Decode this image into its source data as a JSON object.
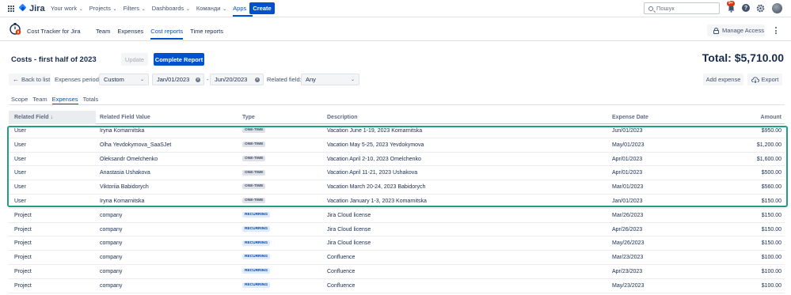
{
  "topnav": {
    "brand": "Jira",
    "menu": [
      {
        "label": "Your work",
        "active": false
      },
      {
        "label": "Projects",
        "active": false
      },
      {
        "label": "Filters",
        "active": false
      },
      {
        "label": "Dashboards",
        "active": false
      },
      {
        "label": "Команди",
        "active": false
      },
      {
        "label": "Apps",
        "active": true
      }
    ],
    "create_label": "Create",
    "search_placeholder": "Пошук",
    "notifications_badge": "9+",
    "help_label": "?"
  },
  "app": {
    "name": "Cost Tracker for Jira",
    "tabs": [
      {
        "label": "Team",
        "active": false
      },
      {
        "label": "Expenses",
        "active": false
      },
      {
        "label": "Cost reports",
        "active": true
      },
      {
        "label": "Time reports",
        "active": false
      }
    ],
    "manage_access_label": "Manage Access"
  },
  "report": {
    "title": "Costs - first half of 2023",
    "update_label": "Update",
    "complete_label": "Complete Report",
    "total": "Total: $5,710.00"
  },
  "filters": {
    "back_label": "Back to list",
    "period_label": "Expenses period:",
    "period_value": "Custom",
    "date_from": "Jan/01/2023",
    "date_to": "Jun/20/2023",
    "date_separator": "-",
    "related_label": "Related field:",
    "related_value": "Any",
    "add_expense_label": "Add expense",
    "export_label": "Export"
  },
  "subtabs": [
    {
      "label": "Scope",
      "active": false
    },
    {
      "label": "Team",
      "active": false
    },
    {
      "label": "Expenses",
      "active": true
    },
    {
      "label": "Totals",
      "active": false
    }
  ],
  "table": {
    "headers": {
      "related_field": "Related Field ↓",
      "related_value": "Related Field Value",
      "type": "Type",
      "description": "Description",
      "date": "Expense Date",
      "amount": "Amount"
    },
    "rows": [
      {
        "field": "User",
        "value": "Iryna Komarnitska",
        "type": "ONE-TIME",
        "kind": "onetime",
        "desc": "Vacation June 1-19, 2023 Komarnitska",
        "date": "Jun/01/2023",
        "amount": "$950.00"
      },
      {
        "field": "User",
        "value": "Olha Yevdokymova_SaaSJet",
        "type": "ONE-TIME",
        "kind": "onetime",
        "desc": "Vacation May 5-25, 2023 Yevdokymova",
        "date": "May/01/2023",
        "amount": "$1,200.00"
      },
      {
        "field": "User",
        "value": "Oleksandr Omelchenko",
        "type": "ONE-TIME",
        "kind": "onetime",
        "desc": "Vacation April 2-10, 2023 Omelchenko",
        "date": "Apr/01/2023",
        "amount": "$1,600.00"
      },
      {
        "field": "User",
        "value": "Anastasia Ushakova",
        "type": "ONE-TIME",
        "kind": "onetime",
        "desc": "Vacation April 11-21, 2023 Ushakova",
        "date": "Apr/01/2023",
        "amount": "$500.00"
      },
      {
        "field": "User",
        "value": "Viktoriia Babidorych",
        "type": "ONE-TIME",
        "kind": "onetime",
        "desc": "Vacation March 20-24, 2023 Babidorych",
        "date": "Mar/01/2023",
        "amount": "$560.00"
      },
      {
        "field": "User",
        "value": "Iryna Komarnitska",
        "type": "ONE-TIME",
        "kind": "onetime",
        "desc": "Vacation January 1-3, 2023 Komarnitska",
        "date": "Jan/01/2023",
        "amount": "$150.00"
      },
      {
        "field": "Project",
        "value": "company",
        "type": "RECURRING",
        "kind": "recurring",
        "desc": "Jira Cloud license",
        "date": "Mar/26/2023",
        "amount": "$150.00"
      },
      {
        "field": "Project",
        "value": "company",
        "type": "RECURRING",
        "kind": "recurring",
        "desc": "Jira Cloud license",
        "date": "Apr/26/2023",
        "amount": "$150.00"
      },
      {
        "field": "Project",
        "value": "company",
        "type": "RECURRING",
        "kind": "recurring",
        "desc": "Jira Cloud license",
        "date": "May/26/2023",
        "amount": "$150.00"
      },
      {
        "field": "Project",
        "value": "company",
        "type": "RECURRING",
        "kind": "recurring",
        "desc": "Confluence",
        "date": "Mar/23/2023",
        "amount": "$100.00"
      },
      {
        "field": "Project",
        "value": "company",
        "type": "RECURRING",
        "kind": "recurring",
        "desc": "Confluence",
        "date": "Apr/23/2023",
        "amount": "$100.00"
      },
      {
        "field": "Project",
        "value": "company",
        "type": "RECURRING",
        "kind": "recurring",
        "desc": "Confluence",
        "date": "May/23/2023",
        "amount": "$100.00"
      }
    ]
  },
  "colors": {
    "primary": "#0052cc",
    "highlight_border": "#1e9e83",
    "badge": "#de350b"
  }
}
